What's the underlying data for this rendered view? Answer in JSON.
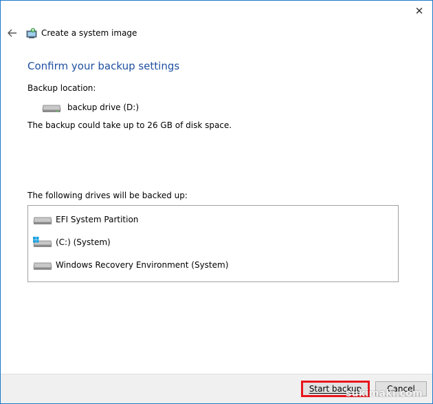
{
  "window": {
    "title": "Create a system image",
    "close_glyph": "✕"
  },
  "page": {
    "heading": "Confirm your backup settings",
    "backup_location_label": "Backup location:",
    "backup_location_value": "backup drive (D:)",
    "space_note": "The backup could take up to 26 GB of disk space.",
    "drives_label": "The following drives will be backed up:"
  },
  "drives": [
    {
      "name": "EFI System Partition",
      "icon": "hard-drive-icon"
    },
    {
      "name": "(C:) (System)",
      "icon": "windows-drive-icon"
    },
    {
      "name": "Windows Recovery Environment (System)",
      "icon": "hard-drive-icon"
    }
  ],
  "footer": {
    "start_label": "Start backup",
    "cancel_label": "Cancel"
  },
  "watermark": "sukimaki.com",
  "colors": {
    "heading": "#1e4fa0",
    "highlight": "#e8141c",
    "windows_logo": "#1ba1e2"
  }
}
